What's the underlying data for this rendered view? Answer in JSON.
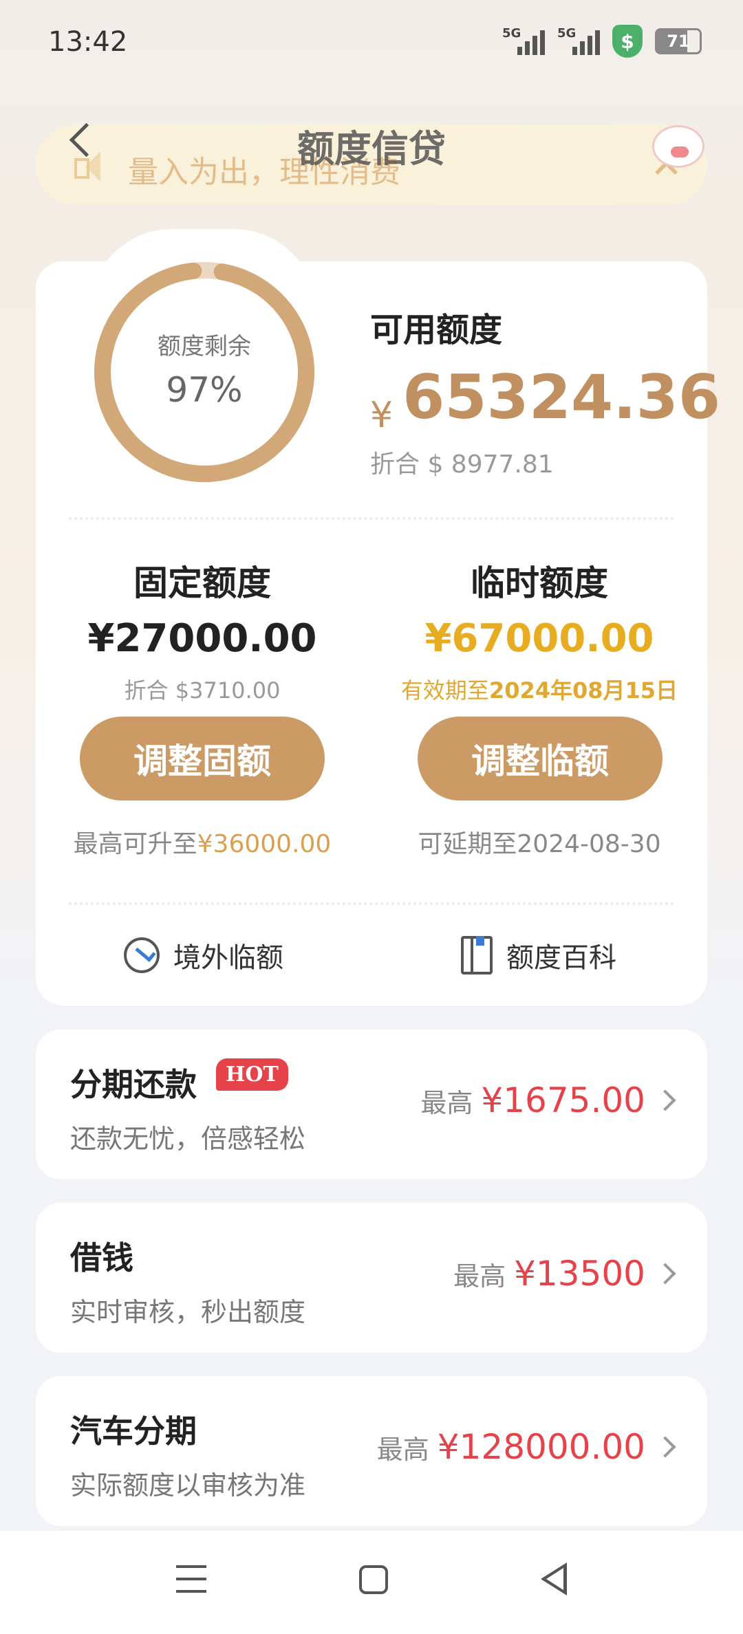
{
  "status_bar": {
    "time": "13:42",
    "network_1": "5G",
    "network_2": "5G",
    "battery": "71"
  },
  "header": {
    "title": "额度信贷",
    "notice_text": "量入为出，理性消费",
    "close_icon": "close-icon",
    "back_icon": "chevron-left-icon"
  },
  "credit": {
    "ring_label": "额度剩余",
    "ring_value": "97%",
    "remaining_fraction": 0.97,
    "available_label": "可用额度",
    "currency_symbol": "¥",
    "available_amount": "65324.36",
    "available_usd": "折合 $ 8977.81",
    "fixed": {
      "title": "固定额度",
      "amount": "¥27000.00",
      "usd": "折合 $3710.00",
      "button": "调整固额",
      "foot_prefix": "最高可升至",
      "foot_value": "¥36000.00"
    },
    "temp": {
      "title": "临时额度",
      "amount": "¥67000.00",
      "validity_prefix": "有效期至",
      "validity_date": "2024年08月15日",
      "button": "调整临额",
      "foot": "可延期至2024-08-30"
    },
    "links": {
      "overseas": "境外临额",
      "wiki": "额度百科"
    }
  },
  "products": [
    {
      "title": "分期还款",
      "badge": "HOT",
      "subtitle": "还款无忧，倍感轻松",
      "max_label": "最高",
      "max_amount": "¥1675.00"
    },
    {
      "title": "借钱",
      "subtitle": "实时审核，秒出额度",
      "max_label": "最高",
      "max_amount": "¥13500"
    },
    {
      "title": "汽车分期",
      "subtitle": "实际额度以审核为准",
      "max_label": "最高",
      "max_amount": "¥128000.00"
    }
  ],
  "colors": {
    "accent_gold": "#cc9a64",
    "temp_amount": "#e8ac20",
    "price_red": "#e5424a",
    "ring_track": "#e8d4bd"
  }
}
